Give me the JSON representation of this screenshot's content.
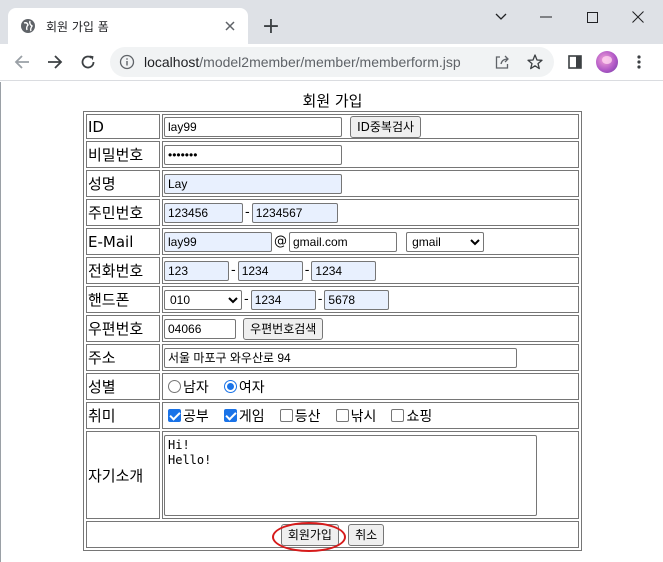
{
  "browser": {
    "tab_title": "회원 가입 폼",
    "new_tab": "+",
    "url_host": "localhost",
    "url_path": "/model2member/member/memberform.jsp"
  },
  "page": {
    "title": "회원 가입"
  },
  "form": {
    "id": {
      "label": "ID",
      "value": "lay99",
      "check_button": "ID중복검사"
    },
    "password": {
      "label": "비밀번호",
      "value": "•••••••"
    },
    "name": {
      "label": "성명",
      "value": "Lay"
    },
    "jumin": {
      "label": "주민번호",
      "first": "123456",
      "sep": "-",
      "second": "1234567"
    },
    "email": {
      "label": "E-Mail",
      "user": "lay99",
      "at": "@",
      "domain": "gmail.com",
      "select": "gmail"
    },
    "phone": {
      "label": "전화번호",
      "p1": "123",
      "p2": "1234",
      "p3": "1234",
      "sep": "-"
    },
    "mobile": {
      "label": "핸드폰",
      "p1": "010",
      "p2": "1234",
      "p3": "5678",
      "sep": "-"
    },
    "zipcode": {
      "label": "우편번호",
      "value": "04066",
      "search_button": "우편번호검색"
    },
    "address": {
      "label": "주소",
      "value": "서울 마포구 와우산로 94"
    },
    "gender": {
      "label": "성별",
      "male": "남자",
      "female": "여자",
      "selected": "female"
    },
    "hobby": {
      "label": "취미",
      "options": [
        {
          "label": "공부",
          "checked": true
        },
        {
          "label": "게임",
          "checked": true
        },
        {
          "label": "등산",
          "checked": false
        },
        {
          "label": "낚시",
          "checked": false
        },
        {
          "label": "쇼핑",
          "checked": false
        }
      ]
    },
    "intro": {
      "label": "자기소개",
      "value": "Hi!\nHello!"
    },
    "submit_button": "회원가입",
    "cancel_button": "취소"
  },
  "colors": {
    "autofill": "#e8f0fe",
    "accent": "#1a73e8",
    "annotation_circle": "#d61a1a"
  }
}
